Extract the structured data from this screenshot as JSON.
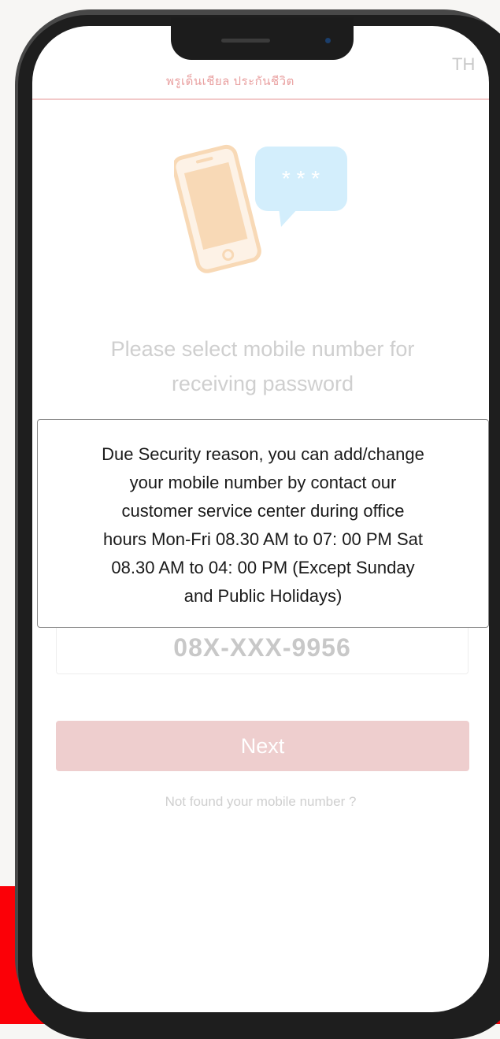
{
  "header": {
    "logo_text": "พรูเด็นเชียล ประกันชีวิต",
    "language": "TH"
  },
  "illustration": {
    "bubble_text": "* * *"
  },
  "main": {
    "title_line1": "Please select mobile number for",
    "title_line2": "receiving password",
    "mobile_number": "08X-XXX-9956",
    "next_label": "Next",
    "not_found_label": "Not found your mobile number ?"
  },
  "tooltip": {
    "lines": [
      "Due Security reason, you can add/change",
      "your mobile number by contact our",
      "customer service center during office",
      "hours Mon-Fri 08.30 AM to 07: 00 PM Sat",
      "08.30 AM to 04: 00 PM (Except Sunday",
      "and Public Holidays)"
    ]
  },
  "colors": {
    "brand_red": "#fb0007",
    "button_pink": "#eecece",
    "bubble_blue": "#d3eefc",
    "phone_orange": "#f8d9b6"
  }
}
